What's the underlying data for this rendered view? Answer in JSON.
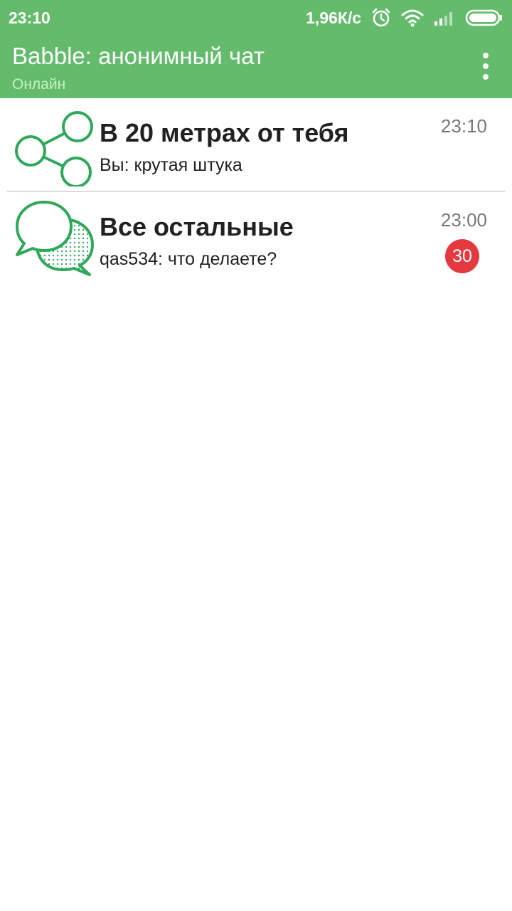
{
  "status_bar": {
    "time": "23:10",
    "net_speed": "1,96К/с",
    "icons": [
      "alarm-icon",
      "wifi-icon",
      "signal-icon",
      "battery-icon"
    ]
  },
  "app_bar": {
    "title": "Babble: анонимный чат",
    "subtitle": "Онлайн",
    "menu_icon": "more-vert-icon"
  },
  "colors": {
    "primary": "#63bb6b",
    "subtitle": "#c8f0c6",
    "icon_green": "#2fa85a",
    "badge_red": "#e53940",
    "text": "#212121",
    "time_gray": "#777777"
  },
  "chats": [
    {
      "title": "В 20 метрах от тебя",
      "preview": "Вы: крутая штука",
      "time": "23:10",
      "icon": "share-nodes-icon"
    },
    {
      "title": "Все остальные",
      "preview": "qas534: что делаете?",
      "time": "23:00",
      "icon": "chat-bubbles-icon",
      "unread": "30"
    }
  ]
}
